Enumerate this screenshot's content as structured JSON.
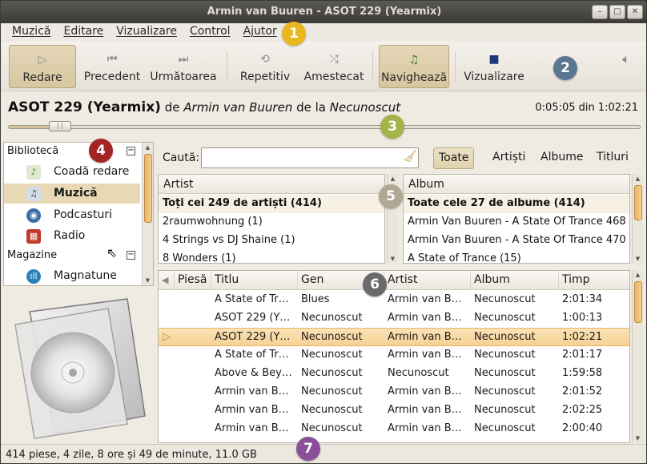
{
  "window": {
    "title": "Armin van Buuren - ASOT 229 (Yearmix)",
    "buttons": {
      "minimize": "–",
      "maximize": "□",
      "close": "✕"
    }
  },
  "menubar": [
    "Muzică",
    "Editare",
    "Vizualizare",
    "Control",
    "Ajutor"
  ],
  "toolbar": {
    "play": "Redare",
    "previous": "Precedent",
    "next": "Următoarea",
    "repeat": "Repetitiv",
    "shuffle": "Amestecat",
    "browse": "Navighează",
    "visualize": "Vizualizare"
  },
  "now_playing": {
    "title": "ASOT 229 (Yearmix)",
    "by": "de",
    "artist": "Armin van Buuren",
    "from": "de la",
    "album": "Necunoscut",
    "time": "0:05:05 din 1:02:21",
    "progress_fraction": 0.081
  },
  "sidebar": {
    "library_header": "Bibliotecă",
    "stores_header": "Magazine",
    "collapse": "−",
    "items": [
      {
        "label": "Coadă redare",
        "icon": "queue-icon"
      },
      {
        "label": "Muzică",
        "icon": "music-icon"
      },
      {
        "label": "Podcasturi",
        "icon": "podcast-icon"
      },
      {
        "label": "Radio",
        "icon": "radio-icon"
      },
      {
        "label": "Magnatune",
        "icon": "magnatune-icon"
      }
    ]
  },
  "search": {
    "label": "Caută:",
    "value": "",
    "filters": [
      "Toate",
      "Artiști",
      "Albume",
      "Titluri"
    ],
    "active_filter": "Toate"
  },
  "artist_pane": {
    "header": "Artist",
    "rows": [
      "Toți cei 249 de artiști (414)",
      "2raumwohnung (1)",
      "4 Strings vs DJ Shaine (1)",
      "8 Wonders (1)"
    ]
  },
  "album_pane": {
    "header": "Album",
    "rows": [
      "Toate cele 27 de albume (414)",
      "Armin Van Buuren - A State Of Trance 468",
      "Armin Van Buuren - A State Of Trance 470",
      "A State of Trance (15)"
    ]
  },
  "tracks": {
    "columns": [
      "Piesă",
      "Titlu",
      "Gen",
      "Artist",
      "Album",
      "Timp"
    ],
    "rows": [
      [
        "",
        "A State of Tr…",
        "Blues",
        "Armin van B…",
        "Necunoscut",
        "2:01:34"
      ],
      [
        "",
        "ASOT 229 (Y…",
        "Necunoscut",
        "Armin van B…",
        "Necunoscut",
        "1:00:13"
      ],
      [
        "",
        "ASOT 229 (Y…",
        "Necunoscut",
        "Armin van B…",
        "Necunoscut",
        "1:02:21"
      ],
      [
        "",
        "A State of Tr…",
        "Necunoscut",
        "Armin van B…",
        "Necunoscut",
        "2:01:17"
      ],
      [
        "",
        "Above & Bey…",
        "Necunoscut",
        "Necunoscut",
        "Necunoscut",
        "1:59:58"
      ],
      [
        "",
        "Armin van B…",
        "Necunoscut",
        "Armin van B…",
        "Necunoscut",
        "2:01:52"
      ],
      [
        "",
        "Armin van B…",
        "Necunoscut",
        "Armin van B…",
        "Necunoscut",
        "2:02:25"
      ],
      [
        "",
        "Armin van B…",
        "Necunoscut",
        "Armin van B…",
        "Necunoscut",
        "2:00:40"
      ]
    ],
    "playing_row": 2
  },
  "status": "414 piese, 4 zile, 8 ore și 49 de minute, 11.0 GB",
  "badges": [
    "1",
    "2",
    "3",
    "4",
    "5",
    "6",
    "7"
  ],
  "colors": {
    "badge1": "#e8b820",
    "badge2": "#5b7691",
    "badge3": "#a4b44a",
    "badge4": "#a42424",
    "badge5": "#b0a892",
    "badge6": "#6a6a6a",
    "badge7": "#8a4f96",
    "selection": "#e8d9b4",
    "playing_row": "#f6d195"
  }
}
